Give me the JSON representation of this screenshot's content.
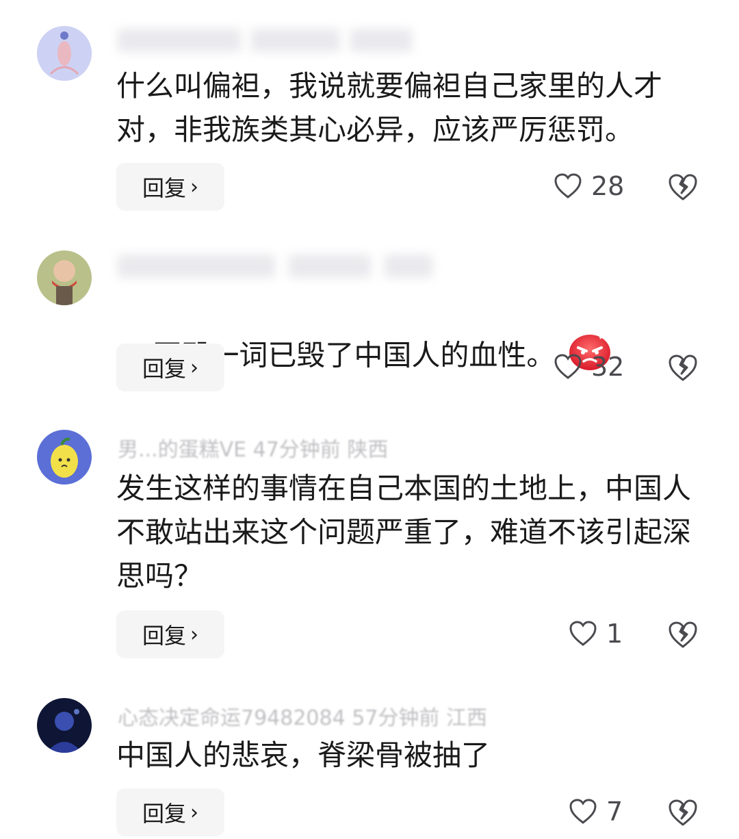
{
  "comments": [
    {
      "meta": "",
      "text": "什么叫偏袒，我说就要偏袒自己家里的人才对，非我族类其心必异，应该严厉惩罚。",
      "reply_label": "回复",
      "likes": "28",
      "avatar_color": "#c9cdf2"
    },
    {
      "meta": "",
      "text": "互殴一词已毁了中国人的血性。",
      "emoji": "angry-face",
      "reply_label": "回复",
      "likes": "32",
      "avatar_color": "#8a9a6a"
    },
    {
      "meta": "男...的蛋糕VE  47分钟前  陕西",
      "text": "发生这样的事情在自己本国的土地上，中国人不敢站出来这个问题严重了，难道不该引起深思吗？",
      "reply_label": "回复",
      "likes": "1",
      "avatar_color": "#5b6fd6"
    },
    {
      "meta": "心态决定命运79482084  57分钟前  江西",
      "text": "中国人的悲哀，脊梁骨被抽了",
      "reply_label": "回复",
      "likes": "7",
      "avatar_color": "#1e2a5a"
    }
  ],
  "icons": {
    "like": "heart-outline-icon",
    "dislike": "broken-heart-icon",
    "chevron": "chevron-right-icon"
  },
  "colors": {
    "reply_bg": "#f5f5f6",
    "text": "#1a1a1a",
    "muted": "#b4b4b8"
  }
}
